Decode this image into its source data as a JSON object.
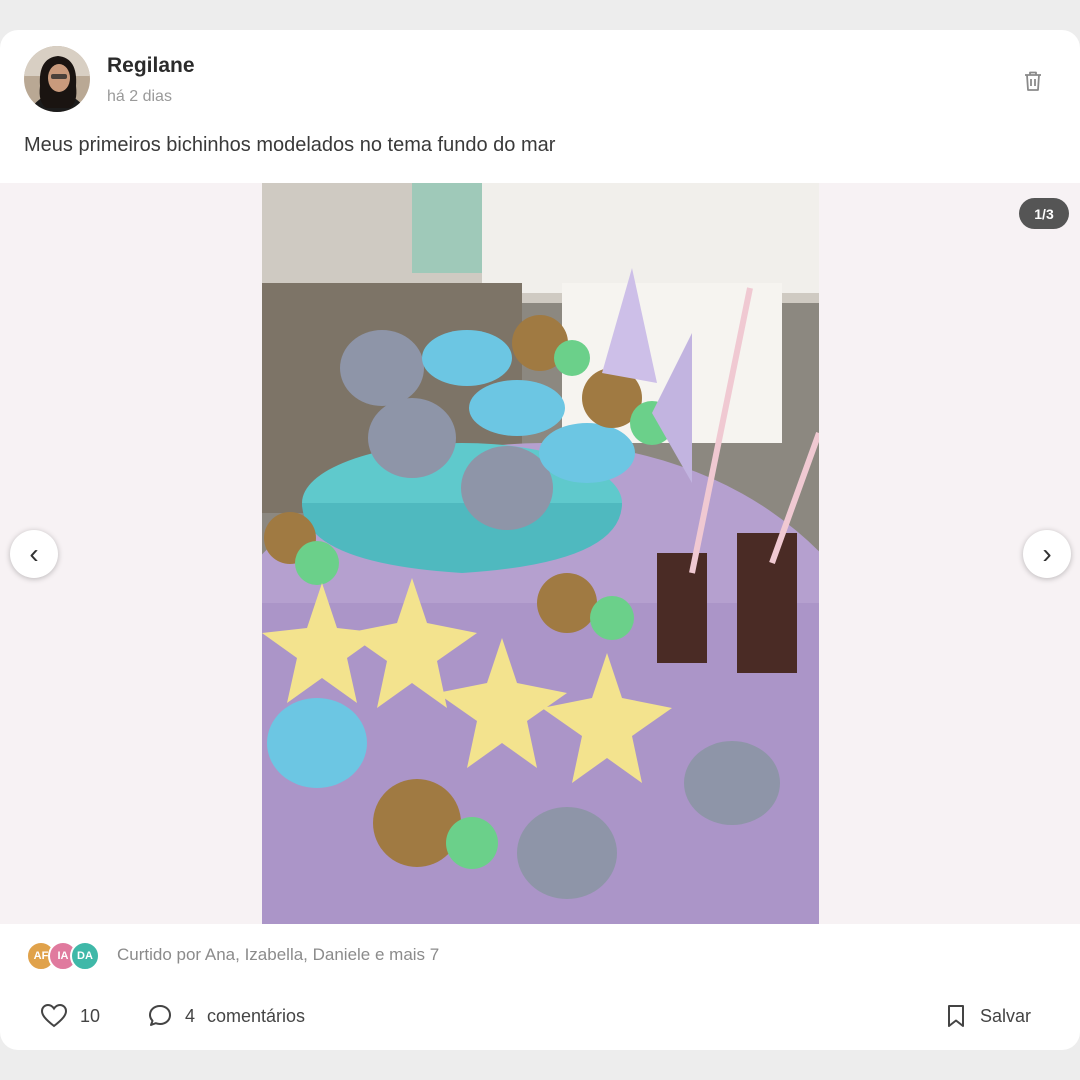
{
  "post": {
    "author": "Regilane",
    "time": "há 2 dias",
    "caption": "Meus primeiros bichinhos modelados no tema fundo do mar",
    "avatar_icon": "user-photo-icon",
    "delete_icon": "trash-icon"
  },
  "media": {
    "counter": "1/3",
    "prev_label": "‹",
    "next_label": "›",
    "slides_total": 3,
    "slide_current": 1,
    "image_icon": "sea-themed-sweets-photo"
  },
  "likes": {
    "avatars": [
      {
        "initials": "AF",
        "color": "#e0a24b"
      },
      {
        "initials": "IA",
        "color": "#e07a9e"
      },
      {
        "initials": "DA",
        "color": "#3fb8a8"
      }
    ],
    "liked_by_text": "Curtido por Ana, Izabella, Daniele e mais 7"
  },
  "actions": {
    "like_count": "10",
    "comment_count": "4",
    "comment_label": "comentários",
    "save_label": "Salvar",
    "like_icon": "heart-icon",
    "comment_icon": "comment-bubble-icon",
    "save_icon": "bookmark-icon"
  },
  "colors": {
    "card_bg": "#ffffff",
    "page_bg": "#ededed",
    "media_bg": "#f7f2f4",
    "counter_bg": "#555555"
  }
}
